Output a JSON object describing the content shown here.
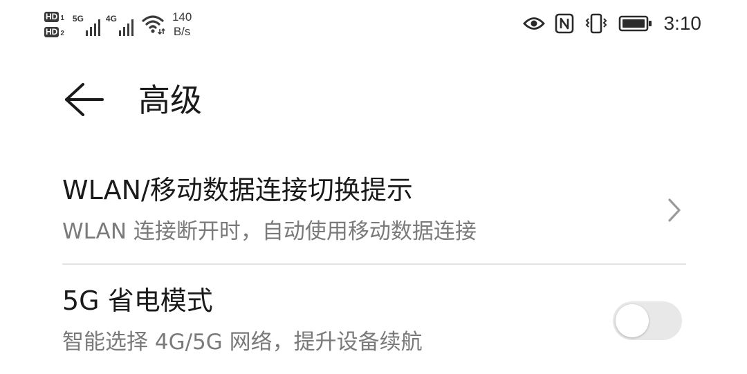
{
  "status_bar": {
    "sim_badges": [
      {
        "label": "HD",
        "sub": "1"
      },
      {
        "label": "HD",
        "sub": "2"
      }
    ],
    "signals": [
      {
        "tag": "5G",
        "icon": "signal-bars-icon"
      },
      {
        "tag": "4G",
        "icon": "signal-bars-icon"
      }
    ],
    "wifi_icon": "wifi-icon",
    "net_speed_value": "140",
    "net_speed_unit": "B/s",
    "right_icons": [
      "eye-icon",
      "nfc-icon",
      "vibrate-icon",
      "battery-icon"
    ],
    "time": "3:10"
  },
  "header": {
    "back_icon": "back-arrow-icon",
    "title": "高级"
  },
  "settings": [
    {
      "title": "WLAN/移动数据连接切换提示",
      "subtitle": "WLAN 连接断开时，自动使用移动数据连接",
      "control": "chevron-right-icon"
    },
    {
      "title": "5G 省电模式",
      "subtitle": "智能选择 4G/5G 网络，提升设备续航",
      "control": "toggle",
      "enabled": false
    }
  ],
  "colors": {
    "text_primary": "#1a1a1a",
    "text_secondary": "#7a7a7a",
    "divider": "#e3e3e3",
    "toggle_off": "#e8e8e8",
    "status_icon": "#3a3a3a"
  }
}
